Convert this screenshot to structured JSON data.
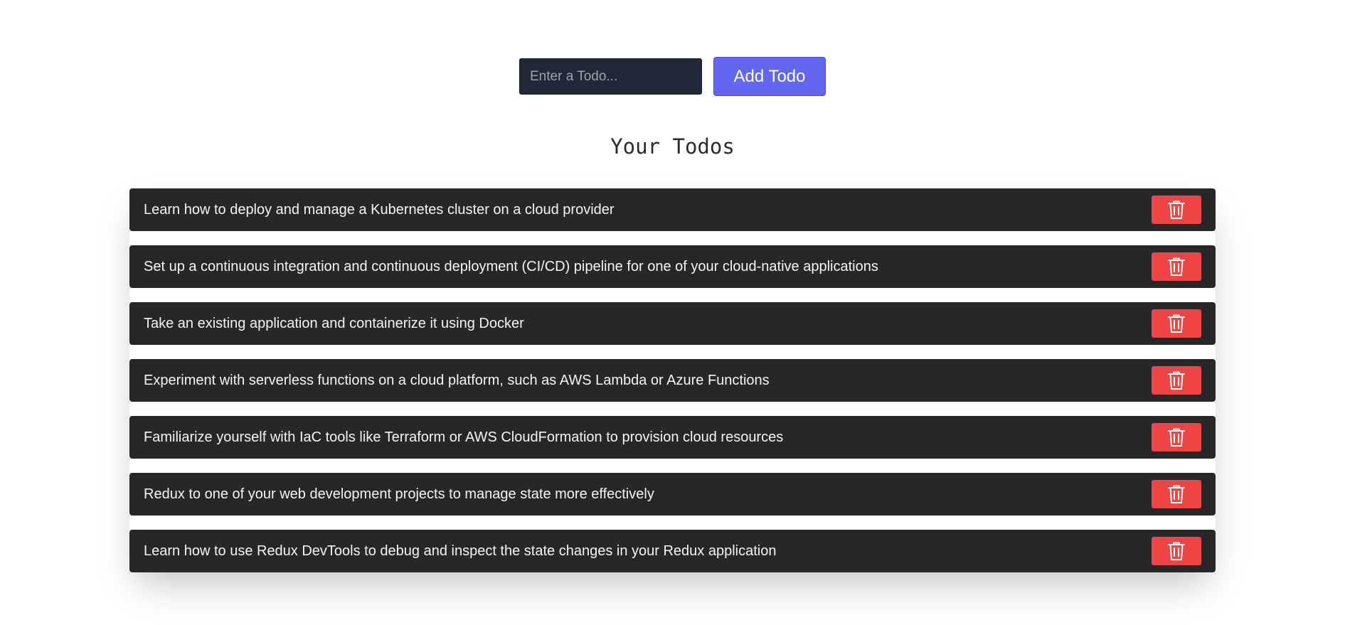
{
  "form": {
    "input_placeholder": "Enter a Todo...",
    "input_value": "",
    "add_button_label": "Add Todo"
  },
  "title": "Your Todos",
  "todos": [
    {
      "text": "Learn how to deploy and manage a Kubernetes cluster on a cloud provider",
      "delete_icon": "trash-icon"
    },
    {
      "text": "Set up a continuous integration and continuous deployment (CI/CD) pipeline for one of your cloud-native applications",
      "delete_icon": "trash-icon"
    },
    {
      "text": "Take an existing application and containerize it using Docker",
      "delete_icon": "trash-icon"
    },
    {
      "text": "Experiment with serverless functions on a cloud platform, such as AWS Lambda or Azure Functions",
      "delete_icon": "trash-icon"
    },
    {
      "text": "Familiarize yourself with IaC tools like Terraform or AWS CloudFormation to provision cloud resources",
      "delete_icon": "trash-icon"
    },
    {
      "text": "Redux to one of your web development projects to manage state more effectively",
      "delete_icon": "trash-icon"
    },
    {
      "text": "Learn how to use Redux DevTools to debug and inspect the state changes in your Redux application",
      "delete_icon": "trash-icon"
    }
  ],
  "colors": {
    "input_background": "#1f2937",
    "add_button": "#6366f1",
    "todo_background": "#27272a",
    "delete_button": "#ef4444"
  }
}
